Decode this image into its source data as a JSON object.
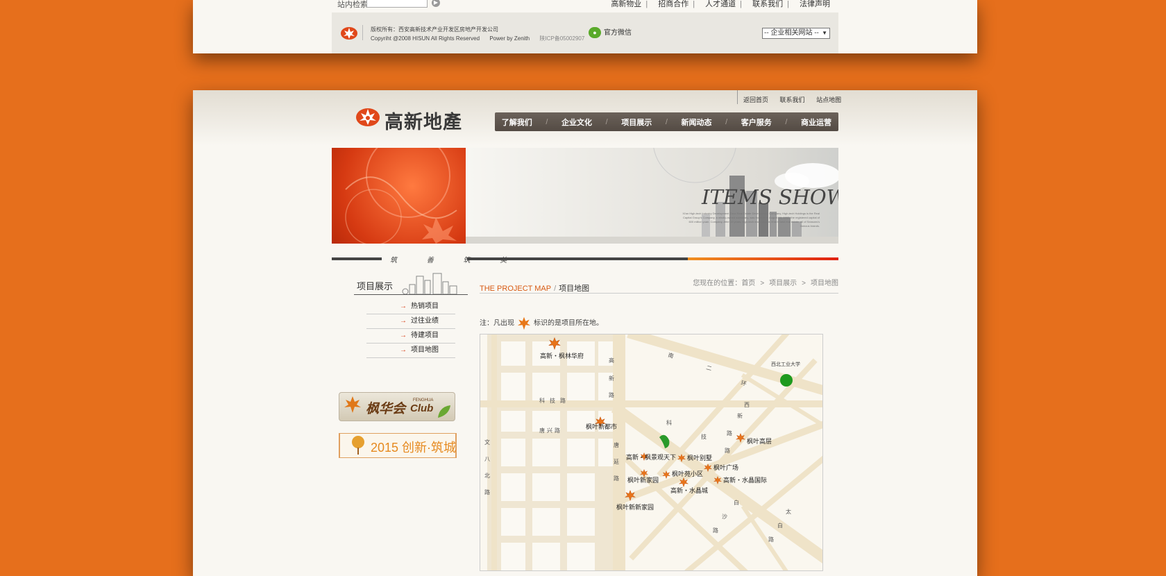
{
  "top_card": {
    "search_label": "站内检索",
    "go_icon": "arrow-right-circle-icon",
    "top_links": [
      "高新物业",
      "招商合作",
      "人才通道",
      "联系我们",
      "法律声明"
    ],
    "footer": {
      "line1": "版权所有：西安高新技术产业开发区房地产开发公司",
      "line2_copyright": "Copyriht @2008 HISUN All Rights Reserved",
      "line2_power": "Power by Zenith",
      "line2_icp": "陕ICP备05002907",
      "wechat_label": "官方微信",
      "related_sites_select": "-- 企业相关网站 --"
    }
  },
  "header": {
    "logo_text": "高新地產",
    "utility_links": [
      "返回首页",
      "联系我们",
      "站点地图"
    ],
    "nav": [
      "了解我们",
      "企业文化",
      "项目展示",
      "新闻动态",
      "客户服务",
      "商业运营"
    ]
  },
  "banner": {
    "title": "ITEMS SHOW",
    "subtitle": "Xi'an High-tech Industry Development Zone Real Estate Development Company, High-tech Holdings is the Real Capital Group's Company, a wholly-owned subsidiary, was founded in August 10, 1992, the registered capital of 600 million yuan. Company, After 15 years, high-tech real estate is Xi'an's best real estate, all of Seasons's famous brands.",
    "stripe_text": "筑 善 筑 美"
  },
  "sidebar": {
    "title": "项目展示",
    "items": [
      "热销项目",
      "过往业绩",
      "待建项目",
      "项目地图"
    ],
    "promo1": "枫华会",
    "promo1_en_top": "FENGHUA",
    "promo1_en": "Club",
    "promo2": "2015 创新·筑城"
  },
  "content": {
    "title_en": "THE PROJECT MAP",
    "title_cn": "项目地图",
    "breadcrumb_prefix": "您现在的位置：",
    "breadcrumb": [
      "首页",
      "项目展示",
      "项目地图"
    ],
    "note_prefix": "注：凡出现",
    "note_suffix": "标识的是项目所在地。"
  },
  "map": {
    "projects": [
      {
        "label": "高新・枫林华府"
      },
      {
        "label": "枫叶新都市"
      },
      {
        "label": "高新・枫景观天下"
      },
      {
        "label": "枫叶别墅"
      },
      {
        "label": "枫叶广场"
      },
      {
        "label": "枫叶苑小区"
      },
      {
        "label": "枫叶新家园"
      },
      {
        "label": "高新・水晶城"
      },
      {
        "label": "高新・水晶国际"
      },
      {
        "label": "枫叶新新家园"
      },
      {
        "label": "枫叶高层"
      }
    ],
    "landmark": "西北工业大学",
    "roads": [
      "南二环",
      "高新路",
      "科技路",
      "唐兴路",
      "科技路",
      "唐延路",
      "文艺北路",
      "太白路",
      "白沙路"
    ]
  }
}
